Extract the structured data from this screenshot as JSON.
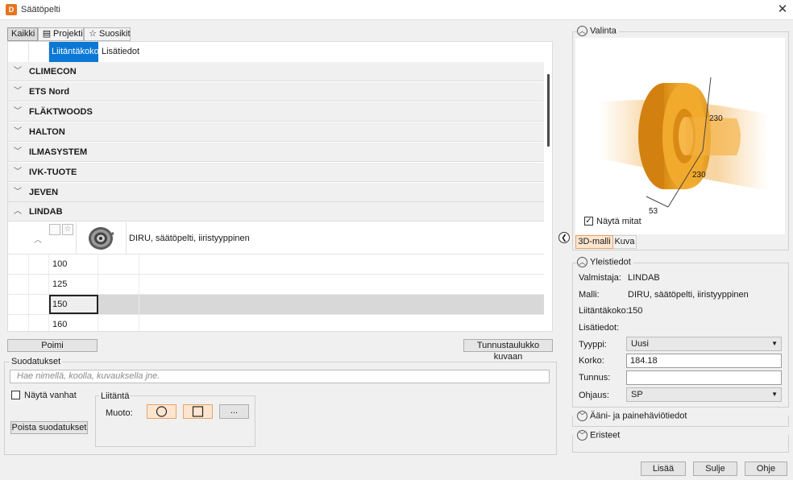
{
  "window": {
    "title": "Säätöpelti",
    "app_icon_letter": "D"
  },
  "tabs": [
    {
      "label": "Kaikki",
      "icon": ""
    },
    {
      "label": "Projekti",
      "icon": "folder-icon"
    },
    {
      "label": "Suosikit",
      "icon": "star-icon"
    }
  ],
  "list": {
    "columns": [
      "Liitäntäkoko",
      "Lisätiedot"
    ],
    "groups": [
      "CLIMECON",
      "ETS Nord",
      "FLÄKTWOODS",
      "HALTON",
      "ILMASYSTEM",
      "IVK-TUOTE",
      "JEVEN",
      "LINDAB"
    ],
    "product": {
      "description": "DIRU, säätöpelti, iiristyyppinen"
    },
    "sizes": [
      "100",
      "125",
      "150",
      "160"
    ],
    "selected_size": "150"
  },
  "buttons": {
    "pick": "Poimi",
    "code_table": "Tunnustaulukko kuvaan",
    "clear_filters": "Poista suodatukset",
    "more_shapes": "...",
    "add": "Lisää",
    "close": "Sulje",
    "help": "Ohje"
  },
  "filters": {
    "title": "Suodatukset",
    "search_placeholder": "Hae nimellä, koolla, kuvauksella jne.",
    "show_old_label": "Näytä vanhat",
    "show_old_checked": false,
    "connection_title": "Liitäntä",
    "shape_label": "Muoto:"
  },
  "selection": {
    "title": "Valinta",
    "show_dimensions_label": "Näytä mitat",
    "show_dimensions_checked": true,
    "dimensions": [
      "230",
      "230",
      "53"
    ],
    "view_tabs": [
      "3D-malli",
      "Kuva"
    ]
  },
  "general": {
    "title": "Yleistiedot",
    "manufacturer_label": "Valmistaja:",
    "manufacturer": "LINDAB",
    "model_label": "Malli:",
    "model": "DIRU, säätöpelti, iiristyyppinen",
    "size_label": "Liitäntäkoko:",
    "size": "150",
    "info_label": "Lisätiedot:",
    "type_label": "Tyyppi:",
    "type": "Uusi",
    "height_label": "Korko:",
    "height": "184.18",
    "id_label": "Tunnus:",
    "id": "",
    "control_label": "Ohjaus:",
    "control": "SP"
  },
  "sections": {
    "sound": "Ääni- ja painehäviötiedot",
    "insulation": "Eristeet"
  },
  "colors": {
    "accent": "#0a78d4",
    "model_orange": "#f0a028",
    "tab_active_bg": "#fde5cf"
  }
}
